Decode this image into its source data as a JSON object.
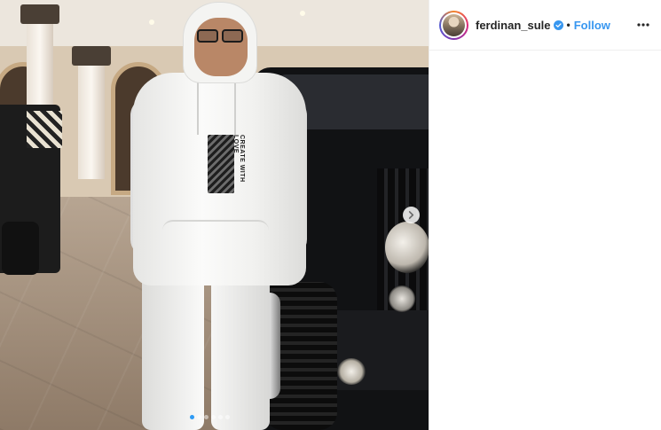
{
  "post": {
    "username": "ferdinan_sule",
    "verified": true,
    "separator": "•",
    "follow_label": "Follow",
    "more_icon": "more-options-icon",
    "next_icon": "chevron-right-icon",
    "hoodie_print_text": "CREATE WITH LOVE",
    "carousel": {
      "total": 6,
      "active": 1
    },
    "colors": {
      "accent": "#3897f0",
      "verified": "#3897f0",
      "active_dot": "#2f9bf5"
    }
  }
}
